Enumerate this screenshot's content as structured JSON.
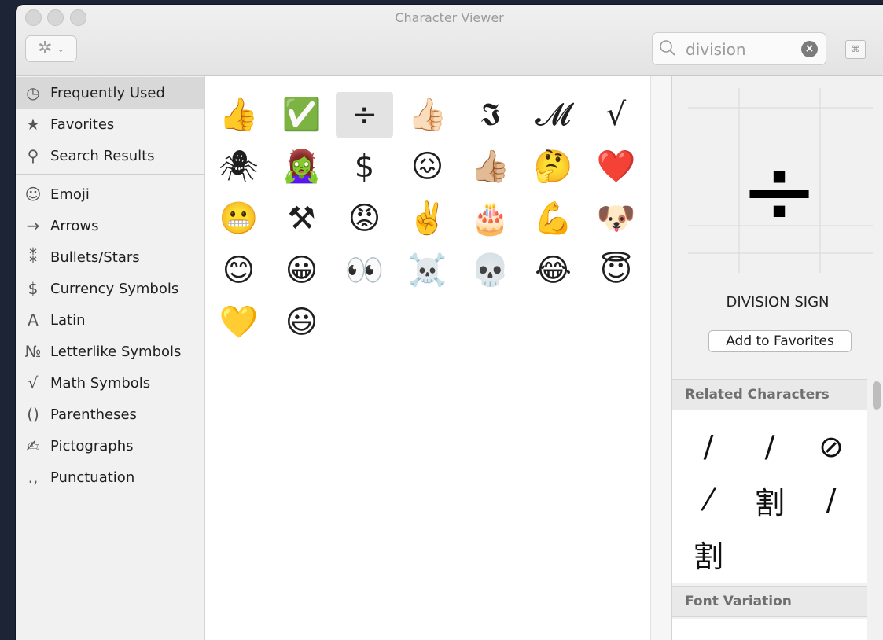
{
  "window": {
    "title": "Character Viewer"
  },
  "toolbar": {
    "gear_icon": "gear-icon",
    "chevron": "⌄"
  },
  "search": {
    "value": "division",
    "clear_icon": "clear-icon"
  },
  "keyboard_viewer": {
    "label": "⌘"
  },
  "sidebar": {
    "items": [
      {
        "icon": "◷",
        "label": "Frequently Used"
      },
      {
        "icon": "★",
        "label": "Favorites"
      },
      {
        "icon": "⚲",
        "label": "Search Results"
      },
      {
        "icon": "☺",
        "label": "Emoji"
      },
      {
        "icon": "→",
        "label": "Arrows"
      },
      {
        "icon": "⁑",
        "label": "Bullets/Stars"
      },
      {
        "icon": "$",
        "label": "Currency Symbols"
      },
      {
        "icon": "A",
        "label": "Latin"
      },
      {
        "icon": "№",
        "label": "Letterlike Symbols"
      },
      {
        "icon": "√",
        "label": "Math Symbols"
      },
      {
        "icon": "()",
        "label": "Parentheses"
      },
      {
        "icon": "✍",
        "label": "Pictographs"
      },
      {
        "icon": ".,",
        "label": "Punctuation"
      }
    ]
  },
  "grid": {
    "chars": [
      "👍",
      "✅",
      "÷",
      "👍🏻",
      "𝕴",
      "𝓜",
      "√",
      "🕷",
      "🧟‍♀️",
      "$",
      "😖",
      "👍🏼",
      "🤔",
      "❤️",
      "😬",
      "⚒",
      "😡",
      "✌️",
      "🎂",
      "💪",
      "🐶",
      "😊",
      "😀",
      "👀",
      "☠️",
      "💀",
      "😂",
      "😇",
      "💛",
      "😃"
    ]
  },
  "detail": {
    "char": "÷",
    "name": "DIVISION SIGN",
    "add_to_favorites": "Add to Favorites",
    "related_header": "Related Characters",
    "related": [
      "/",
      "∕",
      "⊘",
      "⁄",
      "割",
      "/",
      "割"
    ],
    "font_variation_header": "Font Variation"
  }
}
